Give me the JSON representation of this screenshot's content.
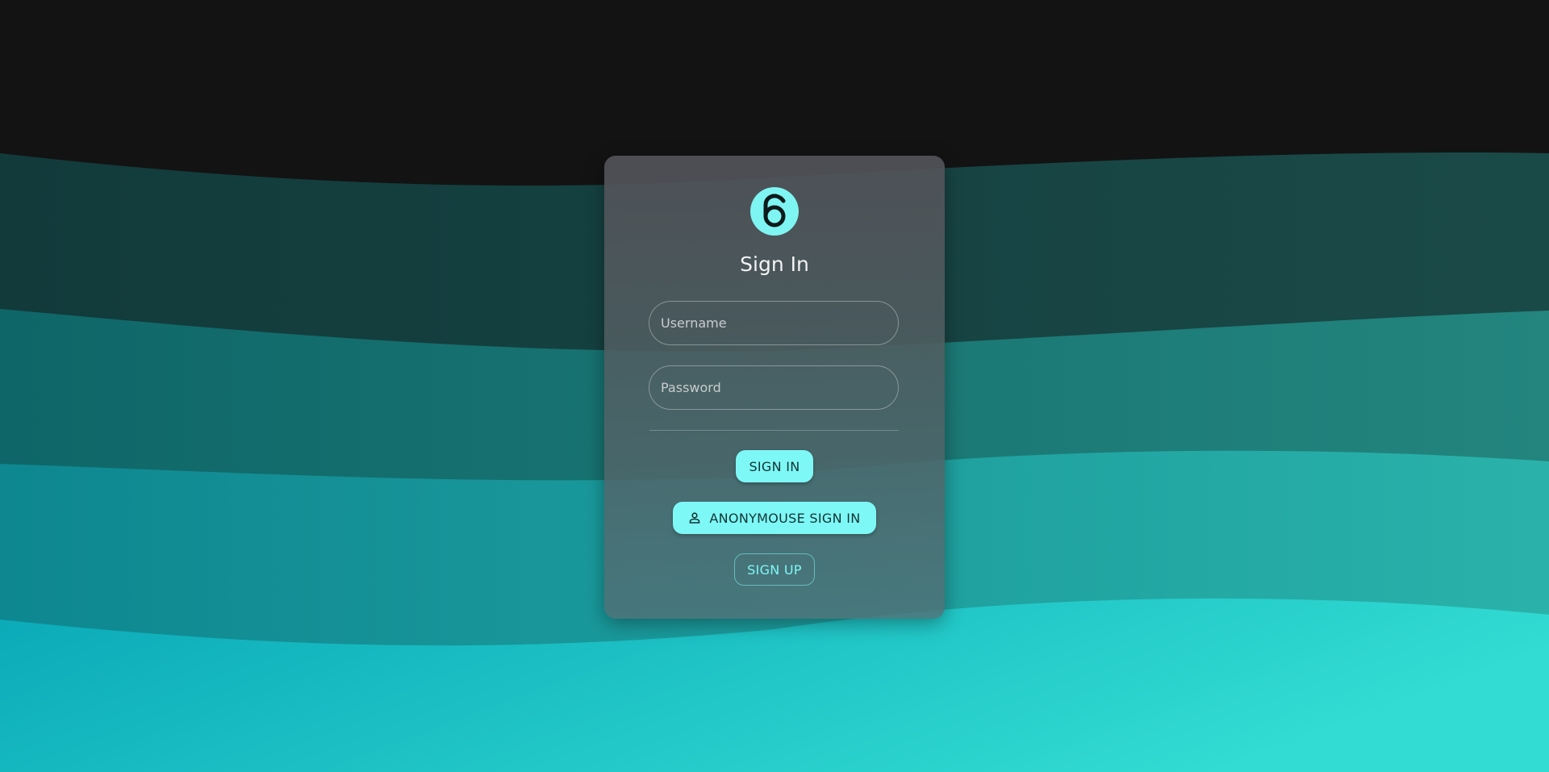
{
  "login_card": {
    "title": "Sign In",
    "username_placeholder": "Username",
    "password_placeholder": "Password",
    "sign_in_label": "SIGN IN",
    "anonymous_sign_in_label": "ANONYMOUSE SIGN IN",
    "sign_up_label": "SIGN UP"
  },
  "icons": {
    "logo": "open-lock-6-logo-icon",
    "anonymous": "person-icon"
  },
  "colors": {
    "background_top": "#131313",
    "accent": "#7ef8f6",
    "wave_dark": "#133c3e",
    "wave_mid": "#106c70",
    "wave_light": "#27c7c7"
  }
}
